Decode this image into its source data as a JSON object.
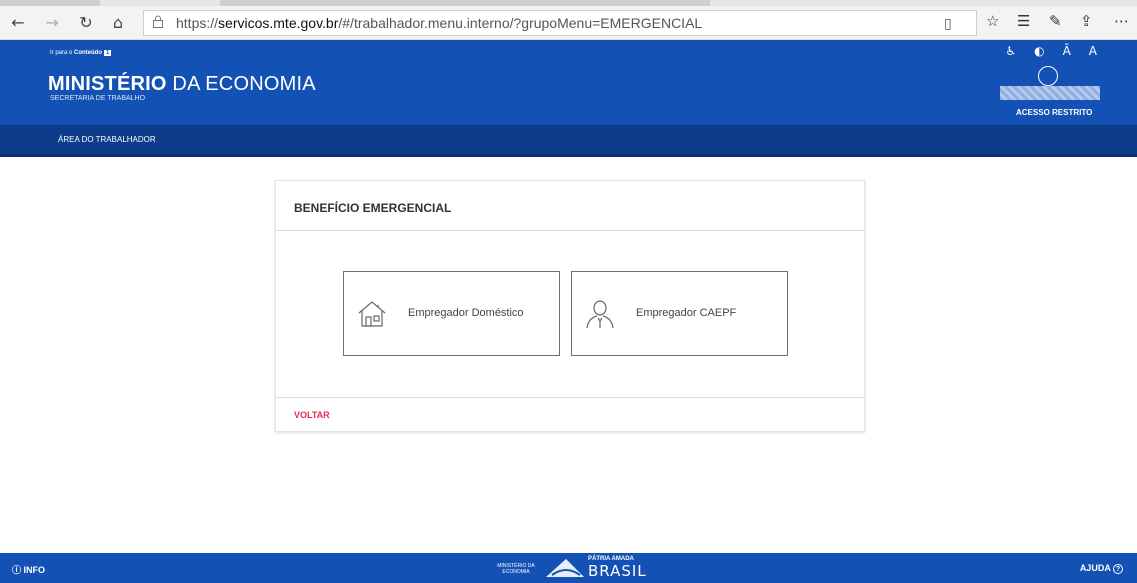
{
  "browser": {
    "url_prefix": "https://",
    "url_host": "servicos.mte.gov.br",
    "url_path": "/#/trabalhador.menu.interno/?grupoMenu=EMERGENCIAL",
    "back_icon": "←",
    "forward_icon": "→",
    "refresh_icon": "↻",
    "home_icon": "⌂",
    "lock_icon": "🔒",
    "reading_icon": "▯",
    "favorite_icon": "☆",
    "favorites_bar_icon": "☰",
    "pen_icon": "✎",
    "share_icon": "⇪",
    "more_icon": "⋯"
  },
  "header": {
    "skip_text": "Ir para o ",
    "skip_link": "Conteúdo",
    "skip_key": "1",
    "title_bold": "MINISTÉRIO",
    "title_rest": " DA ECONOMIA",
    "subtitle": "SECRETARIA DE TRABALHO",
    "access_tools": [
      "♿",
      "◐",
      "Ā",
      "A"
    ],
    "restricted": "ACESSO RESTRITO"
  },
  "subnav": {
    "item": "ÁREA DO TRABALHADOR"
  },
  "card": {
    "title": "BENEFÍCIO EMERGENCIAL",
    "options": [
      {
        "label": "Empregador Doméstico",
        "icon": "house-icon"
      },
      {
        "label": "Empregador CAEPF",
        "icon": "person-icon"
      }
    ],
    "back_label": "VOLTAR"
  },
  "footer": {
    "info_icon": "ⓘ",
    "info_label": "INFO",
    "help_label": "AJUDA",
    "help_icon": "?",
    "logo_ministry": "MINISTÉRIO DA ECONOMIA",
    "logo_motto": "PÁTRIA AMADA",
    "logo_brand": "BRASIL"
  },
  "colors": {
    "gov_blue": "#1351b4",
    "subnav_blue": "#0c3c8a",
    "back_red": "#e52b50"
  }
}
